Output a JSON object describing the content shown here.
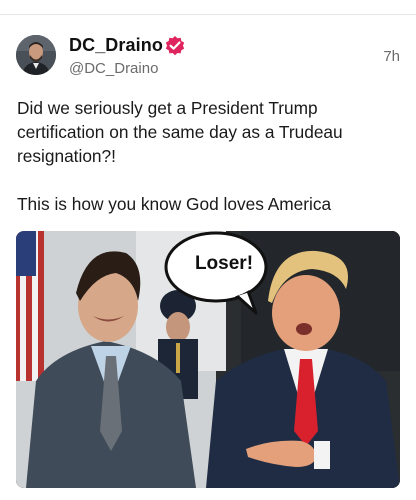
{
  "post": {
    "author_name": "DC_Draino",
    "handle": "@DC_Draino",
    "timestamp": "7h",
    "verified": true,
    "body_lines": [
      "Did we seriously get a President Trump certification on the same day as a Trudeau resignation?!",
      "This is how you know God loves America"
    ]
  },
  "media": {
    "speech_bubble_text": "Loser!"
  },
  "colors": {
    "verified_badge": "#e0245e",
    "text_primary": "#1a1a1a",
    "text_secondary": "#6b6b6b"
  },
  "icons": {
    "verified": "verified-badge-icon"
  }
}
